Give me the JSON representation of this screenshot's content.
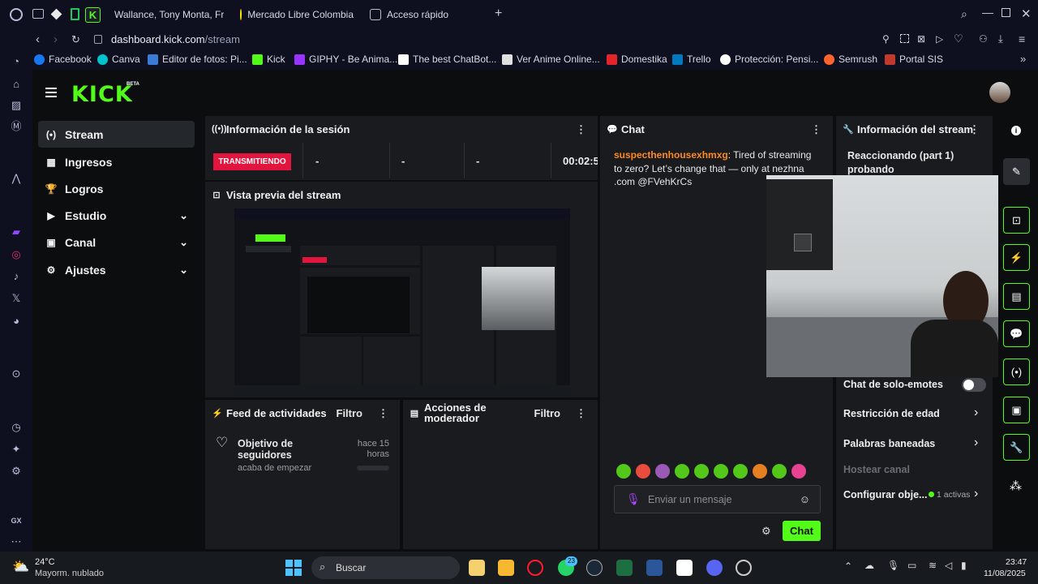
{
  "browser": {
    "tabs": [
      {
        "label": "Wallance, Tony Monta, Fr",
        "color": "#ff0000"
      },
      {
        "label": "Mercado Libre Colombia",
        "color": "#ffe600"
      },
      {
        "label": "Acceso rápido",
        "color": "#b8bcd8"
      }
    ],
    "url_domain": "dashboard.kick.com",
    "url_path": "/stream",
    "bookmarks": [
      {
        "label": "Facebook",
        "color": "#1877f2"
      },
      {
        "label": "Canva",
        "color": "#00c4cc"
      },
      {
        "label": "Editor de fotos: Pi...",
        "color": "#3a7bd5"
      },
      {
        "label": "Kick",
        "color": "#53fc18"
      },
      {
        "label": "GIPHY - Be Anima...",
        "color": "#9933ff"
      },
      {
        "label": "The best ChatBot...",
        "color": "#ffffff"
      },
      {
        "label": "Ver Anime Online...",
        "color": "#e0e0e0"
      },
      {
        "label": "Domestika",
        "color": "#e3242b"
      },
      {
        "label": "Trello",
        "color": "#0079bf"
      },
      {
        "label": "Protección: Pensi...",
        "color": "#ffffff"
      },
      {
        "label": "Semrush",
        "color": "#ff642d"
      },
      {
        "label": "Portal SIS",
        "color": "#c0392b"
      }
    ]
  },
  "app": {
    "logo": "KICK",
    "beta": "BETA",
    "accent": "#53fc18",
    "nav": [
      {
        "label": "Stream",
        "icon": "(•)",
        "active": true,
        "chevron": false
      },
      {
        "label": "Ingresos",
        "icon": "▦",
        "active": false,
        "chevron": false
      },
      {
        "label": "Logros",
        "icon": "🏆",
        "active": false,
        "chevron": false
      },
      {
        "label": "Estudio",
        "icon": "▶",
        "active": false,
        "chevron": true
      },
      {
        "label": "Canal",
        "icon": "▣",
        "active": false,
        "chevron": true
      },
      {
        "label": "Ajustes",
        "icon": "⚙",
        "active": false,
        "chevron": true
      }
    ]
  },
  "session": {
    "title": "Información de la sesión",
    "status": "TRANSMITIENDO",
    "stats": [
      "-",
      "-",
      "-"
    ],
    "timer": "00:02:5"
  },
  "preview": {
    "title": "Vista previa del stream"
  },
  "feed": {
    "title": "Feed de actividades",
    "filter": "Filtro",
    "item_title": "Objetivo de seguidores",
    "item_sub": "acaba de empezar",
    "item_time": "hace 15 horas"
  },
  "mod": {
    "title": "Acciones de moderador",
    "filter": "Filtro"
  },
  "chat": {
    "title": "Chat",
    "message_user": "suspecthenhousexhmxg",
    "message_text": ": Tired of streaming to zero? Let’s change that — only at nezhna .com @FVehKrCs",
    "placeholder": "Enviar un mensaje",
    "send": "Chat"
  },
  "stream_info": {
    "title": "Información del stream",
    "stream_title": "Reaccionando (part 1) probando",
    "emote_only": "Chat de solo-emotes",
    "age": "Restricción de edad",
    "banned": "Palabras baneadas",
    "host": "Hostear canal",
    "goals": "Configurar obje...",
    "goals_count": "1 activas"
  },
  "taskbar": {
    "temp": "24°C",
    "weather": "Mayorm. nublado",
    "search": "Buscar",
    "whatsapp_badge": "23",
    "time": "23:47",
    "date": "11/08/2025"
  }
}
